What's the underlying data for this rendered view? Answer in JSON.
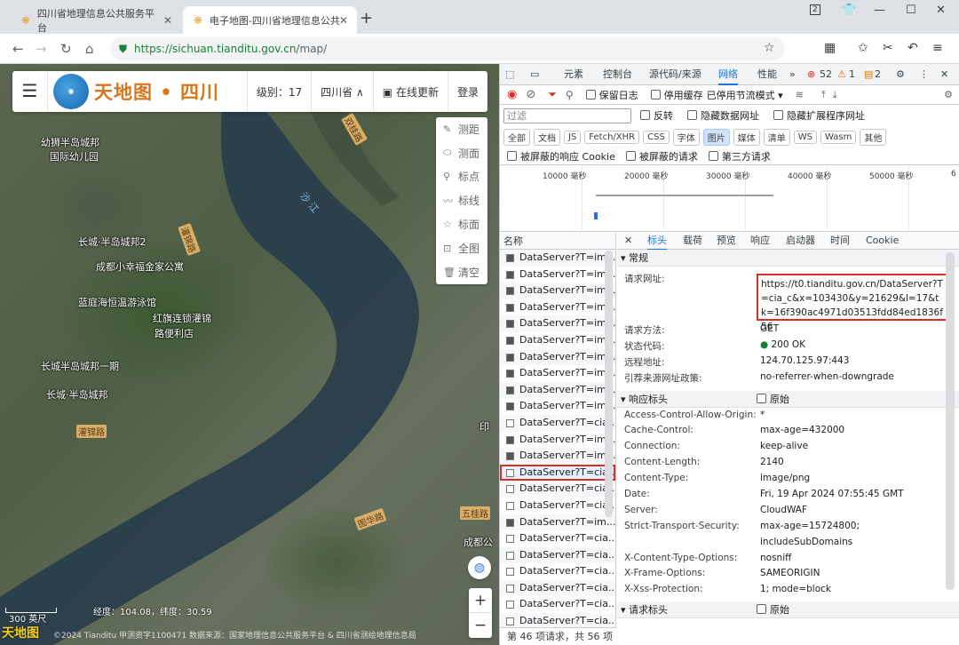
{
  "browser": {
    "tabs": [
      {
        "title": "四川省地理信息公共服务平台"
      },
      {
        "title": "电子地图-四川省地理信息公共"
      }
    ],
    "tab_count": "2",
    "url_host": "https://sichuan.tianditu.gov.cn",
    "url_path": "/map/"
  },
  "map": {
    "logo_text": "天地图 • 四川",
    "level_label": "级别：17",
    "region": "四川省",
    "online_update": "在线更新",
    "login": "登录",
    "tools": [
      "测距",
      "测面",
      "标点",
      "标线",
      "标面",
      "全图",
      "清空"
    ],
    "labels": [
      "幼狮半岛城邦",
      "国际幼儿园",
      "长城·半岛城邦2",
      "成都小幸福金家公寓",
      "蓝庭海恒温游泳馆",
      "红旗连锁灌锦",
      "路便利店",
      "长城半岛城邦一期",
      "长城·半岛城邦",
      "印",
      "成都公"
    ],
    "roads": [
      "灌锦路",
      "灌锦路",
      "五桂路",
      "图华路",
      "双桂路"
    ],
    "river_name": "沙 江",
    "scale": "300 英尺",
    "coords": "经度：104.08，纬度：30.59",
    "footer": "©2024 Tianditu  甲测资字1100471  数据来源：国家地理信息公共服务平台 & 四川省测绘地理信息局",
    "watermark": "天地图"
  },
  "devtools": {
    "tabs": [
      "元素",
      "控制台",
      "源代码/来源",
      "网络",
      "性能"
    ],
    "badges": {
      "errors": "52",
      "warnings": "1",
      "info": "2"
    },
    "controls": {
      "preserve_log": "保留日志",
      "disable_cache": "停用缓存",
      "throttle": "已停用节流模式"
    },
    "filter": {
      "placeholder": "过滤",
      "invert": "反转",
      "hide_data": "隐藏数据网址",
      "hide_ext": "隐藏扩展程序网址"
    },
    "types": [
      "全部",
      "文档",
      "JS",
      "Fetch/XHR",
      "CSS",
      "字体",
      "图片",
      "媒体",
      "清单",
      "WS",
      "Wasm",
      "其他"
    ],
    "cookie_filters": [
      "被屏蔽的响应 Cookie",
      "被屏蔽的请求",
      "第三方请求"
    ],
    "timeline_labels": [
      "10000 毫秒",
      "20000 毫秒",
      "30000 毫秒",
      "40000 毫秒",
      "50000 毫秒",
      "6"
    ],
    "name_header": "名称",
    "requests": [
      "DataServer?T=im...",
      "DataServer?T=im...",
      "DataServer?T=im...",
      "DataServer?T=im...",
      "DataServer?T=im...",
      "DataServer?T=im...",
      "DataServer?T=im...",
      "DataServer?T=im...",
      "DataServer?T=im...",
      "DataServer?T=im...",
      "DataServer?T=cia...",
      "DataServer?T=im...",
      "DataServer?T=im...",
      "DataServer?T=cia...",
      "DataServer?T=cia...",
      "DataServer?T=cia...",
      "DataServer?T=im...",
      "DataServer?T=cia...",
      "DataServer?T=cia...",
      "DataServer?T=cia...",
      "DataServer?T=cia...",
      "DataServer?T=cia...",
      "DataServer?T=cia..."
    ],
    "status": "第 46 项请求，共 56 项",
    "detail_tabs": [
      "标头",
      "载荷",
      "预览",
      "响应",
      "启动器",
      "时间",
      "Cookie"
    ],
    "general": {
      "title": "常规",
      "request_url_key": "请求网址:",
      "request_url": "https://t0.tianditu.gov.cn/DataServer?T=cia_c&x=103430&y=21629&l=17&tk=16f390ac4971d03513fdd84ed1836f56",
      "method_key": "请求方法:",
      "method": "GET",
      "status_key": "状态代码:",
      "status": "200 OK",
      "remote_key": "远程地址:",
      "remote": "124.70.125.97:443",
      "referrer_key": "引荐来源网址政策:",
      "referrer": "no-referrer-when-downgrade"
    },
    "response_headers_title": "响应标头",
    "raw_label": "原始",
    "response_headers": [
      {
        "k": "Access-Control-Allow-Origin:",
        "v": "*"
      },
      {
        "k": "Cache-Control:",
        "v": "max-age=432000"
      },
      {
        "k": "Connection:",
        "v": "keep-alive"
      },
      {
        "k": "Content-Length:",
        "v": "2140"
      },
      {
        "k": "Content-Type:",
        "v": "image/png"
      },
      {
        "k": "Date:",
        "v": "Fri, 19 Apr 2024 07:55:45 GMT"
      },
      {
        "k": "Server:",
        "v": "CloudWAF"
      },
      {
        "k": "Strict-Transport-Security:",
        "v": "max-age=15724800;"
      },
      {
        "k": "",
        "v": "includeSubDomains"
      },
      {
        "k": "X-Content-Type-Options:",
        "v": "nosniff"
      },
      {
        "k": "X-Frame-Options:",
        "v": "SAMEORIGIN"
      },
      {
        "k": "X-Xss-Protection:",
        "v": "1; mode=block"
      }
    ],
    "request_headers_title": "请求标头"
  }
}
